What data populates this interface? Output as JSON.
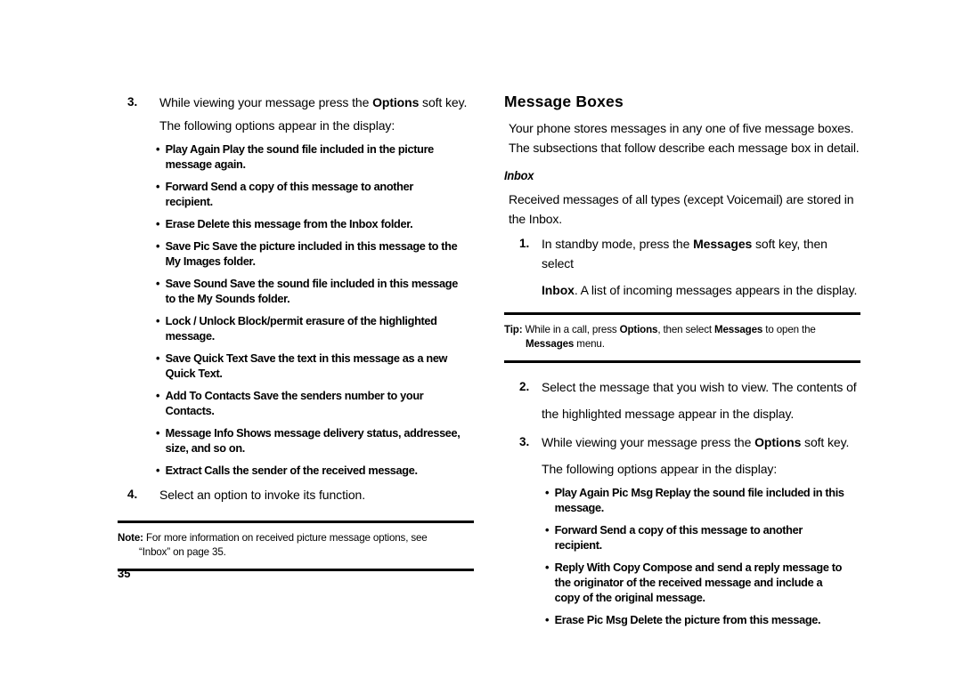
{
  "page": {
    "folio": "35"
  },
  "left_column": {
    "step3": {
      "number": "3.",
      "line1_a": "While viewing your message press the ",
      "line1_bold": "Options",
      "line1_b": " soft key.",
      "line2": "The following options appear in the display:"
    },
    "options": [
      {
        "term": "Play Again",
        "desc": "Play the sound file included in the picture message again."
      },
      {
        "term": "Forward",
        "desc": "Send a copy of this message to another recipient."
      },
      {
        "term": "Erase",
        "desc": "Delete this message from the Inbox folder."
      },
      {
        "term": "Save Pic",
        "desc": "Save the picture included in this message to the My Images folder."
      },
      {
        "term": "Save Sound",
        "desc": "Save the sound file included in this message to the My Sounds folder."
      },
      {
        "term": "Lock / Unlock",
        "desc": "Block/permit erasure of the highlighted message."
      },
      {
        "term": "Save Quick Text",
        "desc": "Save the text in this message as a new Quick Text."
      },
      {
        "term": "Add To Contacts",
        "desc": "Save the senders number to your Contacts."
      },
      {
        "term": "Message Info",
        "desc": "Shows message delivery status, addressee, size, and so on."
      },
      {
        "term": "Extract",
        "desc": "Calls the sender of the received message."
      }
    ],
    "step4": {
      "number": "4.",
      "line1": "Select an option to invoke its function."
    },
    "note": {
      "label": "Note:",
      "line1": " For more information on received picture message options, see",
      "line2": "“Inbox”  on page 35."
    }
  },
  "right_column": {
    "heading": "Message Boxes",
    "intro_line1": "Your phone stores messages in any one of five message boxes.",
    "intro_line2": "The subsections that follow describe each message box in detail.",
    "subheading": "Inbox",
    "inbox_line1": "Received messages of all types (except Voicemail) are stored in",
    "inbox_line2": "the Inbox.",
    "step1": {
      "number": "1.",
      "line1_a": "In standby mode, press the ",
      "line1_bold": "Messages",
      "line1_b": " soft key, then select",
      "line2_bold": "Inbox",
      "line2_b": ". A list of incoming messages appears in the display."
    },
    "tip": {
      "label": "Tip:",
      "text_a": " While in a call, press ",
      "bold1": "Options",
      "text_b": ", then select ",
      "bold2": "Messages",
      "text_c": " to open the",
      "line2_bold": "Messages",
      "line2_b": " menu."
    },
    "step2": {
      "number": "2.",
      "line1": "Select the message that you wish to view. The contents of",
      "line2": "the highlighted message appear in the display."
    },
    "step3": {
      "number": "3.",
      "line1_a": "While viewing your message press the ",
      "line1_bold": "Options",
      "line1_b": " soft key.",
      "line2": "The following options appear in the display:"
    },
    "options": [
      {
        "term": "Play Again  Pic Msg",
        "desc": "Replay the sound file included in this message."
      },
      {
        "term": "Forward",
        "desc": "Send a copy of this message to another recipient."
      },
      {
        "term": "Reply With Copy",
        "desc": "Compose and send a reply message to the originator of the received message and include a copy of the original message."
      },
      {
        "term": "Erase  Pic Msg",
        "desc": "Delete the picture from this message."
      }
    ]
  }
}
